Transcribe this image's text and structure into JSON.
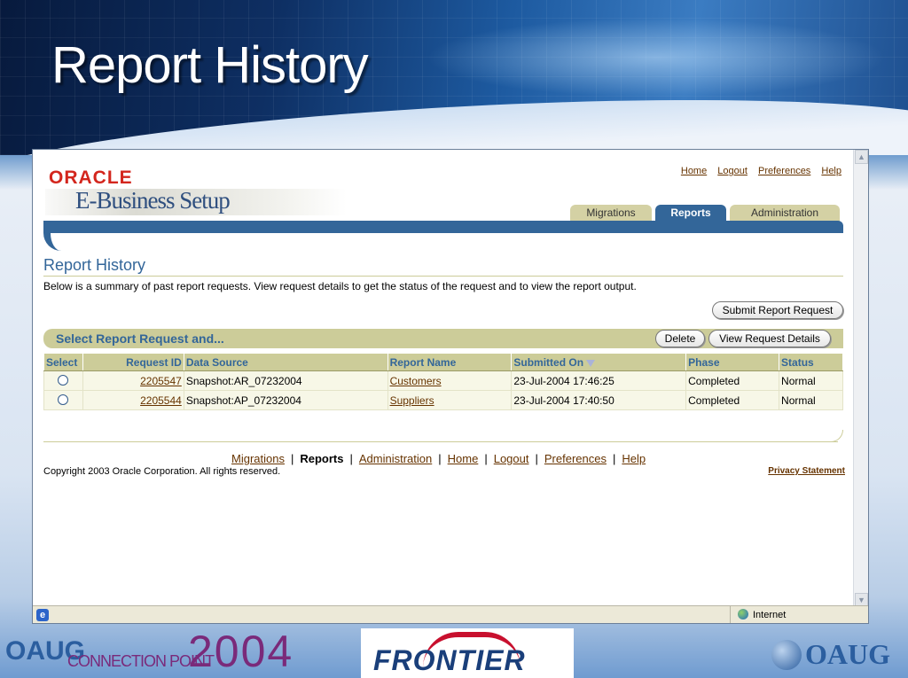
{
  "slide": {
    "title": "Report History",
    "logos": {
      "oaug_left": "OAUG",
      "connection_point": "CONNECTION POINT",
      "year": "2004",
      "frontier": "FRONTIER",
      "oaug_right": "OAUG"
    }
  },
  "app": {
    "brand": "ORACLE",
    "product": "E-Business Setup"
  },
  "global_links": [
    "Home",
    "Logout",
    "Preferences",
    "Help"
  ],
  "tabs": [
    {
      "label": "Migrations",
      "active": false
    },
    {
      "label": "Reports",
      "active": true
    },
    {
      "label": "Administration",
      "active": false
    }
  ],
  "page": {
    "heading": "Report History",
    "intro": "Below is a summary of past report requests. View request details to get the status of the request and to view the report output.",
    "submit_button": "Submit Report Request"
  },
  "select_bar": {
    "title": "Select Report Request and...",
    "delete_button": "Delete",
    "view_button": "View Request Details"
  },
  "table": {
    "columns": [
      "Select",
      "Request ID",
      "Data Source",
      "Report Name",
      "Submitted On",
      "Phase",
      "Status"
    ],
    "rows": [
      {
        "request_id": "2205547",
        "data_source": "Snapshot:AR_07232004",
        "report_name": "Customers",
        "submitted_on": "23-Jul-2004 17:46:25",
        "phase": "Completed",
        "status": "Normal"
      },
      {
        "request_id": "2205544",
        "data_source": "Snapshot:AP_07232004",
        "report_name": "Suppliers",
        "submitted_on": "23-Jul-2004 17:40:50",
        "phase": "Completed",
        "status": "Normal"
      }
    ]
  },
  "footer": {
    "links": [
      "Migrations",
      "Reports",
      "Administration",
      "Home",
      "Logout",
      "Preferences",
      "Help"
    ],
    "current": "Reports",
    "copyright": "Copyright 2003 Oracle Corporation. All rights reserved.",
    "privacy": "Privacy Statement"
  },
  "statusbar": {
    "zone": "Internet"
  }
}
